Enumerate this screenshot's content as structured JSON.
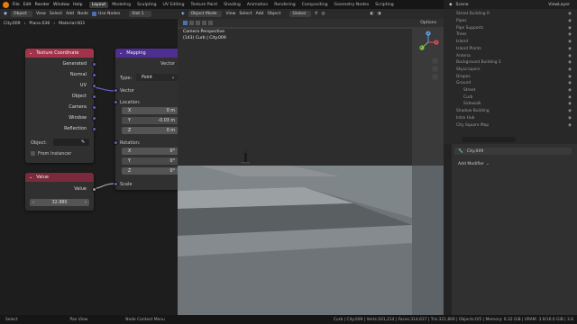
{
  "menu": {
    "items": [
      "File",
      "Edit",
      "Render",
      "Window",
      "Help"
    ],
    "workspaces": [
      "Layout",
      "Modeling",
      "Sculpting",
      "UV Editing",
      "Texture Paint",
      "Shading",
      "Animation",
      "Rendering",
      "Compositing",
      "Geometry Nodes",
      "Scripting"
    ],
    "active_workspace": "Layout",
    "scene": "Scene",
    "view_layer": "ViewLayer"
  },
  "node_editor": {
    "header": {
      "mode": "Object",
      "view": "View",
      "select": "Select",
      "add": "Add",
      "node": "Node",
      "use_nodes": "Use Nodes",
      "slot": "Slot 1"
    },
    "breadcrumb": [
      "City.009",
      "Plane.036",
      "Material.003"
    ],
    "texture_coordinate": {
      "title": "Texture Coordinate",
      "outputs": [
        "Generated",
        "Normal",
        "UV",
        "Object",
        "Camera",
        "Window",
        "Reflection"
      ],
      "object_label": "Object:",
      "from_instancer": "From Instancer"
    },
    "mapping": {
      "title": "Mapping",
      "output": "Vector",
      "type_label": "Type:",
      "type_value": "Point",
      "vector_label": "Vector",
      "location_label": "Location:",
      "location": [
        [
          "X",
          "0 m"
        ],
        [
          "Y",
          "-0.03 m"
        ],
        [
          "Z",
          "0 m"
        ]
      ],
      "rotation_label": "Rotation:",
      "rotation": [
        [
          "X",
          "0°"
        ],
        [
          "Y",
          "0°"
        ],
        [
          "Z",
          "0°"
        ]
      ],
      "scale_label": "Scale"
    },
    "value_node": {
      "title": "Value",
      "output": "Value",
      "value": "32.980"
    },
    "colors": {
      "texture_header": "#a3334a",
      "vector_header": "#4e2e91",
      "value_header": "#7a2a3c",
      "socket_vector": "#6363c7",
      "socket_float": "#a1a1a1"
    }
  },
  "viewport": {
    "header": {
      "mode": "Object Mode",
      "view": "View",
      "select": "Select",
      "add": "Add",
      "object": "Object",
      "orientation": "Global",
      "options": "Options"
    },
    "camera_label": "Camera Perspective",
    "object_label": "(143) Curb | City.009",
    "gizmo_axes": [
      "X",
      "Y",
      "Z"
    ]
  },
  "outliner": {
    "items": [
      {
        "name": "Street Building R",
        "indent": 0
      },
      {
        "name": "Pipes",
        "indent": 0
      },
      {
        "name": "Pipe Supports",
        "indent": 0
      },
      {
        "name": "Trees",
        "indent": 0
      },
      {
        "name": "Island",
        "indent": 0
      },
      {
        "name": "Island Plants",
        "indent": 0
      },
      {
        "name": "Antena",
        "indent": 0
      },
      {
        "name": "Background Building 3",
        "indent": 0
      },
      {
        "name": "Skyscrapers",
        "indent": 0
      },
      {
        "name": "Drapes",
        "indent": 0
      },
      {
        "name": "Ground",
        "indent": 0
      },
      {
        "name": "Street",
        "indent": 1
      },
      {
        "name": "Curb",
        "indent": 1
      },
      {
        "name": "Sidewalk",
        "indent": 1
      },
      {
        "name": "Shadow Building",
        "indent": 0
      },
      {
        "name": "Intro Hub",
        "indent": 0
      },
      {
        "name": "City Square Map",
        "indent": 0
      }
    ]
  },
  "properties": {
    "object_name": "City.009",
    "add_modifier": "Add Modifier"
  },
  "statusbar": {
    "select": "Select",
    "pan_view": "Pan View",
    "node_menu": "Node Context Menu",
    "stats": "Curb | City.009 | Verts:161,214 | Faces:314,637 | Tris:321,806 | Objects:0/5 | Memory: 6.32 GiB | VRAM: 3.9/16.0 GiB | 3.6"
  }
}
